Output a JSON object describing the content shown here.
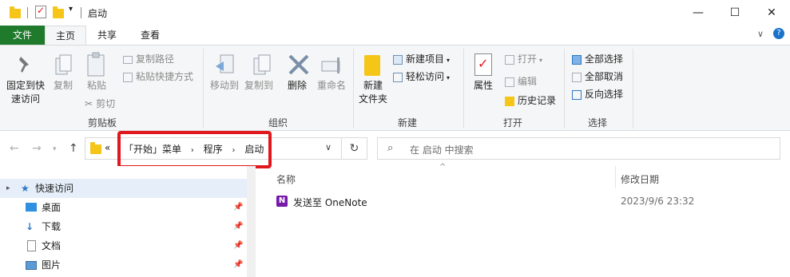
{
  "titlebar": {
    "title": "启动",
    "minimize": "—",
    "maximize": "☐",
    "close": "✕"
  },
  "tabs": {
    "file": "文件",
    "home": "主页",
    "share": "共享",
    "view": "查看"
  },
  "ribbon": {
    "clipboard": {
      "group": "剪贴板",
      "pin_line1": "固定到快",
      "pin_line2": "速访问",
      "copy": "复制",
      "paste": "粘贴",
      "copy_path": "复制路径",
      "paste_shortcut": "粘贴快捷方式",
      "cut": "剪切"
    },
    "organize": {
      "group": "组织",
      "move_to": "移动到",
      "copy_to": "复制到",
      "delete": "删除",
      "rename": "重命名"
    },
    "new": {
      "group": "新建",
      "new_folder_line1": "新建",
      "new_folder_line2": "文件夹",
      "new_item": "新建项目",
      "easy_access": "轻松访问"
    },
    "open": {
      "group": "打开",
      "properties": "属性",
      "open": "打开",
      "edit": "编辑",
      "history": "历史记录"
    },
    "select": {
      "group": "选择",
      "select_all": "全部选择",
      "select_none": "全部取消",
      "invert": "反向选择"
    }
  },
  "address": {
    "overflow": "«",
    "crumbs": [
      "「开始」菜单",
      "程序",
      "启动"
    ],
    "search_placeholder": "在 启动 中搜索"
  },
  "nav": {
    "quick_access": "快速访问",
    "items": [
      "桌面",
      "下载",
      "文档",
      "图片"
    ]
  },
  "content": {
    "col_name": "名称",
    "col_date": "修改日期",
    "files": [
      {
        "name": "发送至 OneNote",
        "date": "2023/9/6 23:32"
      }
    ]
  },
  "colors": {
    "file_tab": "#1f7a2c",
    "highlight": "#e0181e",
    "folder": "#f5c518",
    "selection": "#e5eef9",
    "onenote": "#7719aa"
  }
}
